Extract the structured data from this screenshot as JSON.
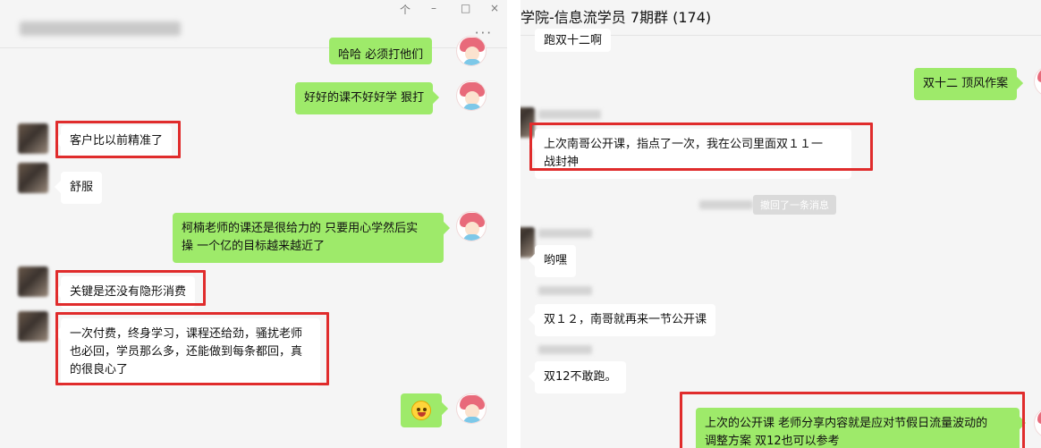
{
  "left_window": {
    "window_controls": {
      "pin": "个",
      "minimize": "–",
      "maximize": "□",
      "close": "×"
    },
    "more_label": "···",
    "cut_top_text": "哈哈 必须打他们",
    "messages": {
      "m1": "好好的课不好好学  狠打",
      "m2": "客户比以前精准了",
      "m3": "舒服",
      "m4_line1": "柯楠老师的课还是很给力的 只要用心学然后实",
      "m4_line2": "操 一个亿的目标越来越近了",
      "m5": "关键是还没有隐形消费",
      "m6_line1": "一次付费，终身学习，课程还给劲，骚扰老师",
      "m6_line2": "也必回，学员那么多，还能做到每条都回，真",
      "m6_line3": "的很良心了"
    }
  },
  "right_window": {
    "title": "学院-信息流学员 7期群 (174)",
    "cut_top_text": "跑双十二啊",
    "messages": {
      "r1": "双十二 顶风作案",
      "r2_line1": "上次南哥公开课，指点了一次，我在公司里面双１１一",
      "r2_line2": "战封神",
      "recall_note": "撤回了一条消息",
      "r3": "哟嘿",
      "r4": "双１２，南哥就再来一节公开课",
      "r5": "双12不敢跑。",
      "r6_line1": "上次的公开课 老师分享内容就是应对节假日流量波动的",
      "r6_line2": "调整方案  双12也可以参考"
    }
  },
  "colors": {
    "highlight": "#e02c2c",
    "sent_bubble": "#9eea6a",
    "received_bubble": "#ffffff"
  }
}
